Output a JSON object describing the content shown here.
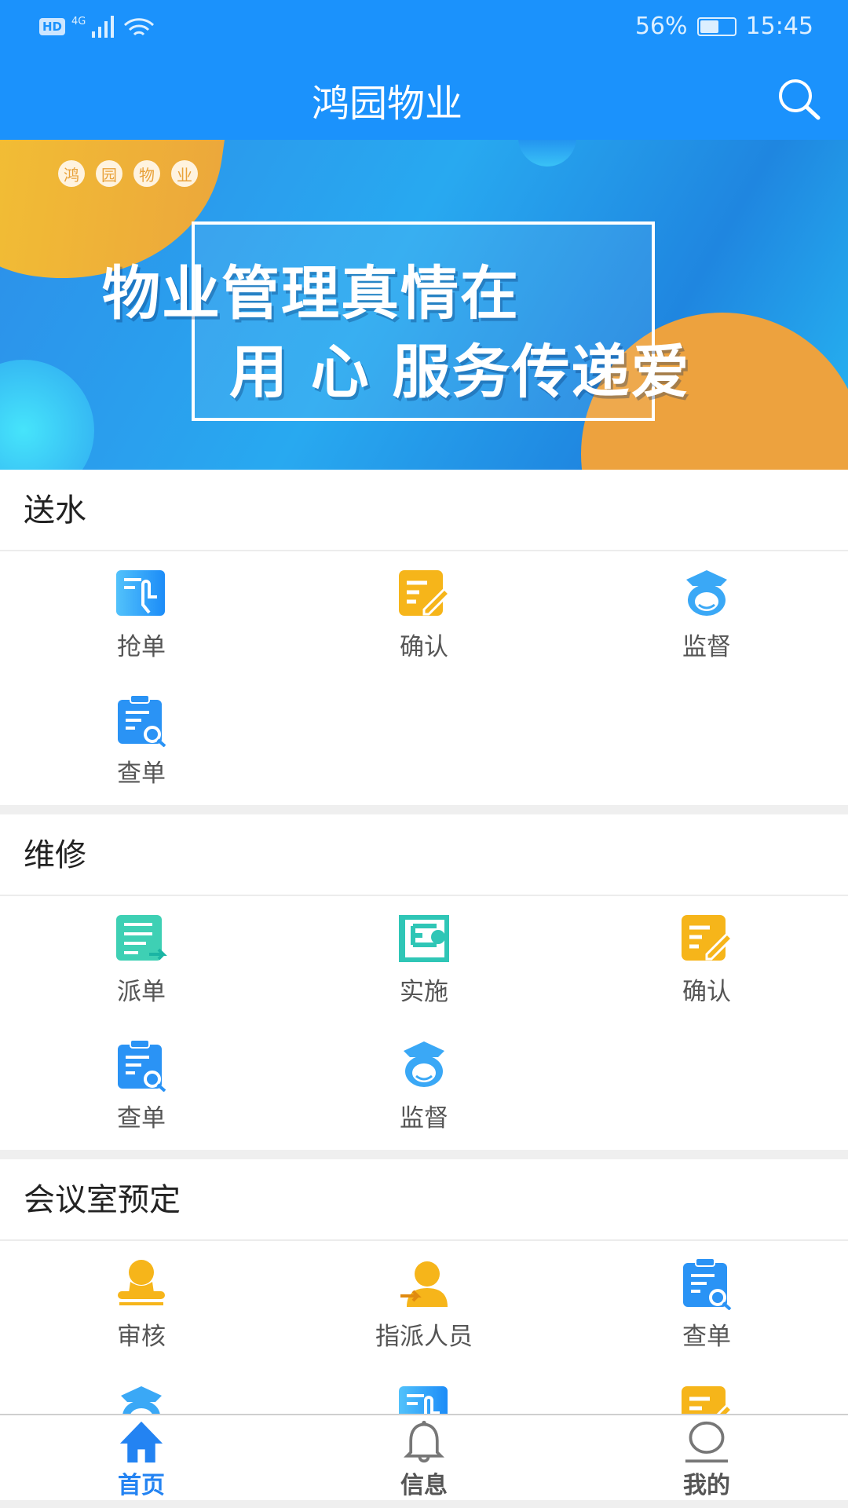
{
  "status": {
    "network": "4G",
    "hd": "HD",
    "battery": "56%",
    "battery_level": 0.56,
    "time": "15:45"
  },
  "header": {
    "title": "鸿园物业"
  },
  "banner": {
    "badges": [
      "鸿",
      "园",
      "物",
      "业"
    ],
    "slogan_line1": "物业管理真情在",
    "slogan_line2": "用 心 服务传递爱"
  },
  "sections": [
    {
      "title": "送水",
      "items": [
        {
          "label": "抢单",
          "icon": "grab-order"
        },
        {
          "label": "确认",
          "icon": "confirm"
        },
        {
          "label": "监督",
          "icon": "supervise"
        },
        {
          "label": "查单",
          "icon": "check-order"
        }
      ]
    },
    {
      "title": "维修",
      "items": [
        {
          "label": "派单",
          "icon": "dispatch"
        },
        {
          "label": "实施",
          "icon": "implement"
        },
        {
          "label": "确认",
          "icon": "confirm"
        },
        {
          "label": "查单",
          "icon": "check-order"
        },
        {
          "label": "监督",
          "icon": "supervise"
        }
      ]
    },
    {
      "title": "会议室预定",
      "items": [
        {
          "label": "审核",
          "icon": "review"
        },
        {
          "label": "指派人员",
          "icon": "assign"
        },
        {
          "label": "查单",
          "icon": "check-order"
        },
        {
          "label": "",
          "icon": "supervise"
        },
        {
          "label": "",
          "icon": "grab-order"
        },
        {
          "label": "",
          "icon": "confirm"
        }
      ]
    }
  ],
  "tabs": [
    {
      "label": "首页",
      "icon": "home",
      "active": true
    },
    {
      "label": "信息",
      "icon": "bell"
    },
    {
      "label": "我的",
      "icon": "user"
    }
  ],
  "colors": {
    "primary": "#1b92fc",
    "tab_active": "#2383f2",
    "orange": "#f5b31a",
    "teal": "#2cc4b0"
  }
}
